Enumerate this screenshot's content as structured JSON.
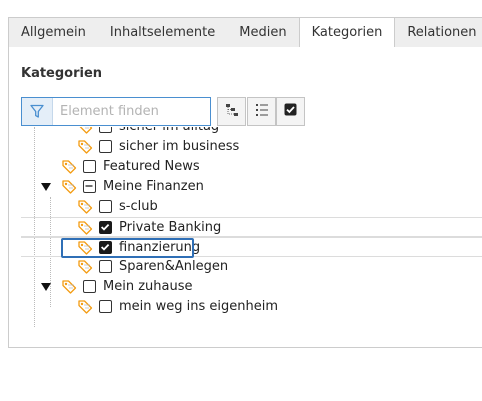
{
  "tabs": [
    {
      "label": "Allgemein",
      "active": false
    },
    {
      "label": "Inhaltselemente",
      "active": false
    },
    {
      "label": "Medien",
      "active": false
    },
    {
      "label": "Kategorien",
      "active": true
    },
    {
      "label": "Relationen",
      "active": false
    }
  ],
  "section": {
    "heading": "Kategorien"
  },
  "filter": {
    "placeholder": "Element finden",
    "value": ""
  },
  "toolbar": [
    {
      "icon": "tree-collapse-icon"
    },
    {
      "icon": "list-icon"
    },
    {
      "icon": "checkbox-checked-icon"
    }
  ],
  "tree": {
    "items": [
      {
        "label": "sicher im alltag",
        "checked": false
      },
      {
        "label": "sicher im business",
        "checked": false
      },
      {
        "label": "Featured News",
        "checked": false
      },
      {
        "label": "Meine Finanzen",
        "checked": "partial",
        "expanded": true
      },
      {
        "label": "s-club",
        "checked": false
      },
      {
        "label": "Private Banking",
        "checked": true
      },
      {
        "label": "finanzierung",
        "checked": true,
        "focused": true
      },
      {
        "label": "Sparen&Anlegen",
        "checked": false
      },
      {
        "label": "Mein zuhause",
        "checked": false,
        "expanded": true
      },
      {
        "label": "mein weg ins eigenheim",
        "checked": false
      }
    ]
  },
  "colors": {
    "tag_icon": "#f39c12",
    "focus": "#2f6fb6",
    "checked": "#1a1a1a"
  }
}
